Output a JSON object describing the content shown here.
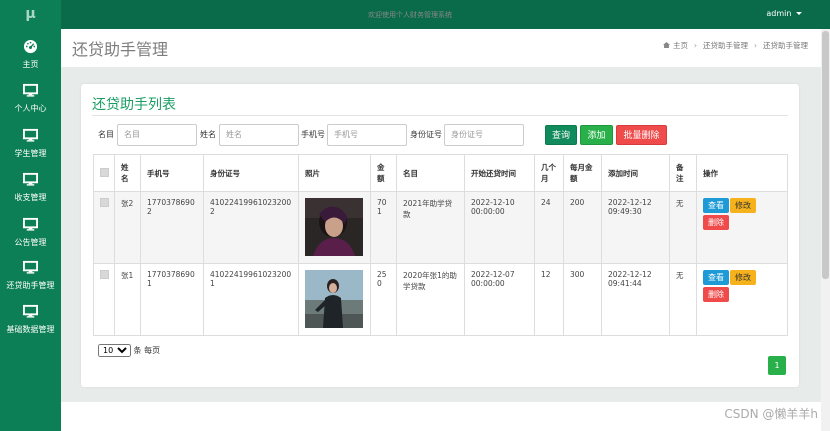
{
  "app": {
    "logo": "μ",
    "user": "admin"
  },
  "sidebar": {
    "items": [
      {
        "label": "主页",
        "icon": "dashboard-icon"
      },
      {
        "label": "个人中心",
        "icon": "monitor-icon"
      },
      {
        "label": "学生管理",
        "icon": "monitor-icon"
      },
      {
        "label": "收支管理",
        "icon": "monitor-icon"
      },
      {
        "label": "公告管理",
        "icon": "monitor-icon"
      },
      {
        "label": "还贷助手管理",
        "icon": "monitor-icon"
      },
      {
        "label": "基础数据管理",
        "icon": "monitor-icon"
      }
    ]
  },
  "header": {
    "title": "还贷助手管理",
    "breadcrumb": [
      "主页",
      "还贷助手管理",
      "还贷助手管理"
    ]
  },
  "panel": {
    "title": "还贷助手列表",
    "filters": [
      {
        "label": "名目",
        "placeholder": "名目"
      },
      {
        "label": "姓名",
        "placeholder": "姓名"
      },
      {
        "label": "手机号",
        "placeholder": "手机号"
      },
      {
        "label": "身份证号",
        "placeholder": "身份证号"
      }
    ],
    "buttons": {
      "query": "查询",
      "add": "添加",
      "batch_delete": "批量删除"
    }
  },
  "table": {
    "headers": [
      "姓名",
      "手机号",
      "身份证号",
      "照片",
      "金额",
      "名目",
      "开始还贷时间",
      "几个月",
      "每月金额",
      "添加时间",
      "备注",
      "操作"
    ],
    "rows": [
      {
        "name": "张2",
        "phone": "17703786902",
        "id_card": "410224199610232002",
        "amount": "701",
        "item": "2021年助学贷款",
        "start_time": "2022-12-10 00:00:00",
        "months": "24",
        "monthly": "200",
        "add_time": "2022-12-12 09:49:30",
        "note": "无"
      },
      {
        "name": "张1",
        "phone": "17703786901",
        "id_card": "410224199610232001",
        "amount": "250",
        "item": "2020年张1的助学贷款",
        "start_time": "2022-12-07 00:00:00",
        "months": "12",
        "monthly": "300",
        "add_time": "2022-12-12 09:41:44",
        "note": "无"
      }
    ],
    "actions": {
      "view": "查看",
      "edit": "修改",
      "delete": "删除"
    }
  },
  "pagination": {
    "page_size": "10",
    "per_page_label": "条 每页",
    "current_page": "1"
  },
  "footer": {
    "text": "欢迎使用个人财务管理系统"
  },
  "watermark": "CSDN @懒羊羊h",
  "colors": {
    "topbar": "#0a6b4a",
    "sidebar": "#0d7f57",
    "title_green": "#1a9c63",
    "danger": "#ef4b4b",
    "warning": "#f6b21b",
    "info": "#1e9ad6"
  }
}
